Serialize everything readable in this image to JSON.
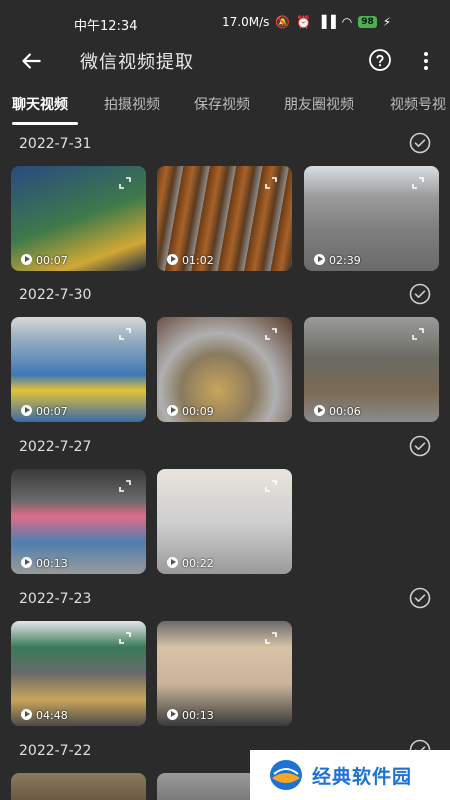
{
  "status_bar": {
    "time": "中午12:34",
    "speed": "17.0M/s",
    "battery": "98"
  },
  "app_bar": {
    "title": "微信视频提取",
    "back_icon": "arrow-left-icon",
    "help_icon": "question-circle-icon",
    "more_icon": "more-vert-icon"
  },
  "tabs": [
    {
      "label": "聊天视频",
      "active": true
    },
    {
      "label": "拍摄视频",
      "active": false
    },
    {
      "label": "保存视频",
      "active": false
    },
    {
      "label": "朋友圈视频",
      "active": false
    },
    {
      "label": "视频号视",
      "active": false
    }
  ],
  "sections": [
    {
      "date": "2022-7-31",
      "videos": [
        {
          "duration": "00:07",
          "color": "#2d4a7a"
        },
        {
          "duration": "01:02",
          "color": "#7a4a22"
        },
        {
          "duration": "02:39",
          "color": "#8a8a8a"
        }
      ]
    },
    {
      "date": "2022-7-30",
      "videos": [
        {
          "duration": "00:07",
          "color": "#3b6ea8"
        },
        {
          "duration": "00:09",
          "color": "#6b5a4a"
        },
        {
          "duration": "00:06",
          "color": "#6f6a62"
        }
      ]
    },
    {
      "date": "2022-7-27",
      "videos": [
        {
          "duration": "00:13",
          "color": "#5a5a5a"
        },
        {
          "duration": "00:22",
          "color": "#cfcfcf"
        }
      ]
    },
    {
      "date": "2022-7-23",
      "videos": [
        {
          "duration": "04:48",
          "color": "#4a5f6a"
        },
        {
          "duration": "00:13",
          "color": "#c9b49a"
        }
      ]
    },
    {
      "date": "2022-7-22",
      "videos": [
        {
          "duration": "",
          "color": "#6a5a45"
        },
        {
          "duration": "",
          "color": "#8a8a8a"
        }
      ]
    }
  ],
  "watermark": {
    "text": "经典软件园"
  }
}
